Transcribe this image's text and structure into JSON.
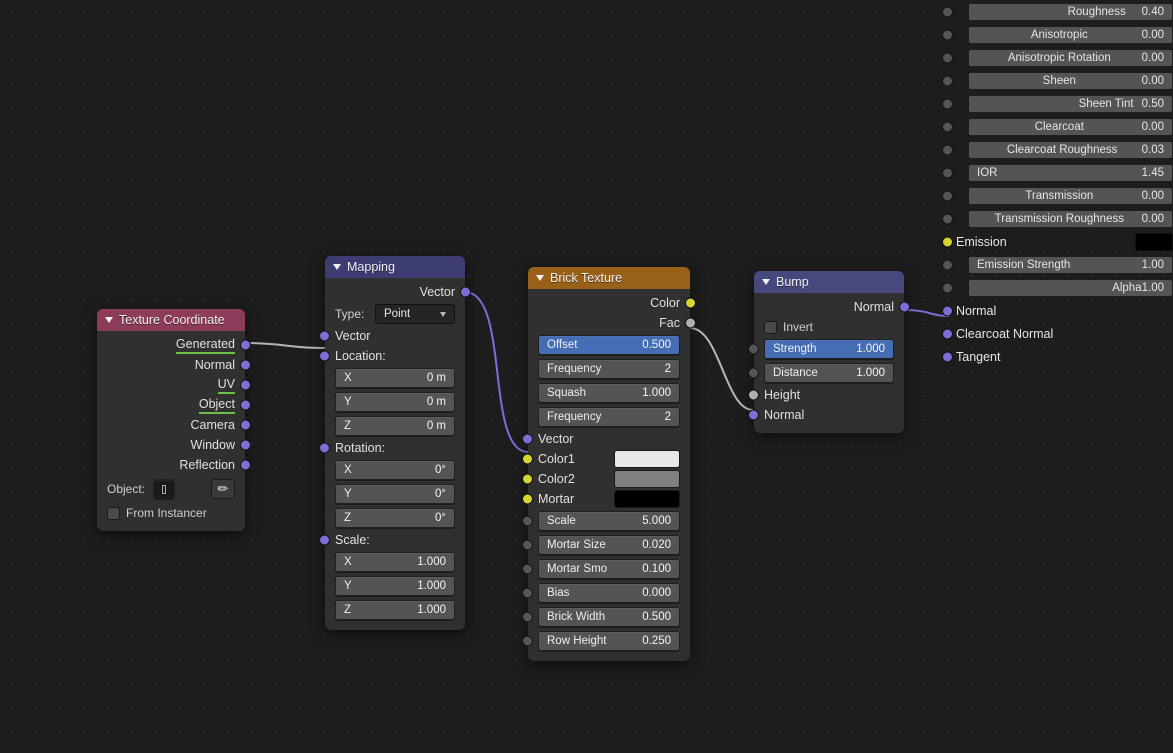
{
  "texcoord": {
    "title": "Texture Coordinate",
    "outs": [
      "Generated",
      "Normal",
      "UV",
      "Object",
      "Camera",
      "Window",
      "Reflection"
    ],
    "object_label": "Object:",
    "from_instancer": "From Instancer"
  },
  "mapping": {
    "title": "Mapping",
    "out_vector": "Vector",
    "type_label": "Type:",
    "type_value": "Point",
    "in_vector": "Vector",
    "location_label": "Location:",
    "loc_x_l": "X",
    "loc_x_v": "0 m",
    "loc_y_l": "Y",
    "loc_y_v": "0 m",
    "loc_z_l": "Z",
    "loc_z_v": "0 m",
    "rotation_label": "Rotation:",
    "rot_x_l": "X",
    "rot_x_v": "0°",
    "rot_y_l": "Y",
    "rot_y_v": "0°",
    "rot_z_l": "Z",
    "rot_z_v": "0°",
    "scale_label": "Scale:",
    "scl_x_l": "X",
    "scl_x_v": "1.000",
    "scl_y_l": "Y",
    "scl_y_v": "1.000",
    "scl_z_l": "Z",
    "scl_z_v": "1.000"
  },
  "brick": {
    "title": "Brick Texture",
    "out_color": "Color",
    "out_fac": "Fac",
    "offset_l": "Offset",
    "offset_v": "0.500",
    "freq1_l": "Frequency",
    "freq1_v": "2",
    "squash_l": "Squash",
    "squash_v": "1.000",
    "freq2_l": "Frequency",
    "freq2_v": "2",
    "in_vector": "Vector",
    "color1": "Color1",
    "color1_hex": "#e8e8e8",
    "color2": "Color2",
    "color2_hex": "#808080",
    "mortar": "Mortar",
    "mortar_hex": "#000000",
    "scale_l": "Scale",
    "scale_v": "5.000",
    "msize_l": "Mortar Size",
    "msize_v": "0.020",
    "msmo_l": "Mortar Smo",
    "msmo_v": "0.100",
    "bias_l": "Bias",
    "bias_v": "0.000",
    "bw_l": "Brick Width",
    "bw_v": "0.500",
    "rh_l": "Row Height",
    "rh_v": "0.250"
  },
  "bump": {
    "title": "Bump",
    "out_normal": "Normal",
    "invert": "Invert",
    "strength_l": "Strength",
    "strength_v": "1.000",
    "distance_l": "Distance",
    "distance_v": "1.000",
    "height": "Height",
    "normal": "Normal"
  },
  "bsdf": {
    "rough_l": "Roughness",
    "rough_v": "0.40",
    "rough_f": 0.4,
    "aniso_l": "Anisotropic",
    "aniso_v": "0.00",
    "aniso_f": 0.0,
    "anirot_l": "Anisotropic Rotation",
    "anirot_v": "0.00",
    "anirot_f": 0.0,
    "sheen_l": "Sheen",
    "sheen_v": "0.00",
    "sheen_f": 0.0,
    "sheent_l": "Sheen Tint",
    "sheent_v": "0.50",
    "sheent_f": 0.5,
    "clear_l": "Clearcoat",
    "clear_v": "0.00",
    "clear_f": 0.0,
    "clearr_l": "Clearcoat Roughness",
    "clearr_v": "0.03",
    "clearr_f": 0.03,
    "ior_l": "IOR",
    "ior_v": "1.45",
    "trans_l": "Transmission",
    "trans_v": "0.00",
    "trans_f": 0.0,
    "transr_l": "Transmission Roughness",
    "transr_v": "0.00",
    "transr_f": 0.0,
    "emission": "Emission",
    "emstr_l": "Emission Strength",
    "emstr_v": "1.00",
    "alpha_l": "Alpha",
    "alpha_v": "1.00",
    "alpha_f": 1.0,
    "normal": "Normal",
    "cnormal": "Clearcoat Normal",
    "tangent": "Tangent"
  }
}
